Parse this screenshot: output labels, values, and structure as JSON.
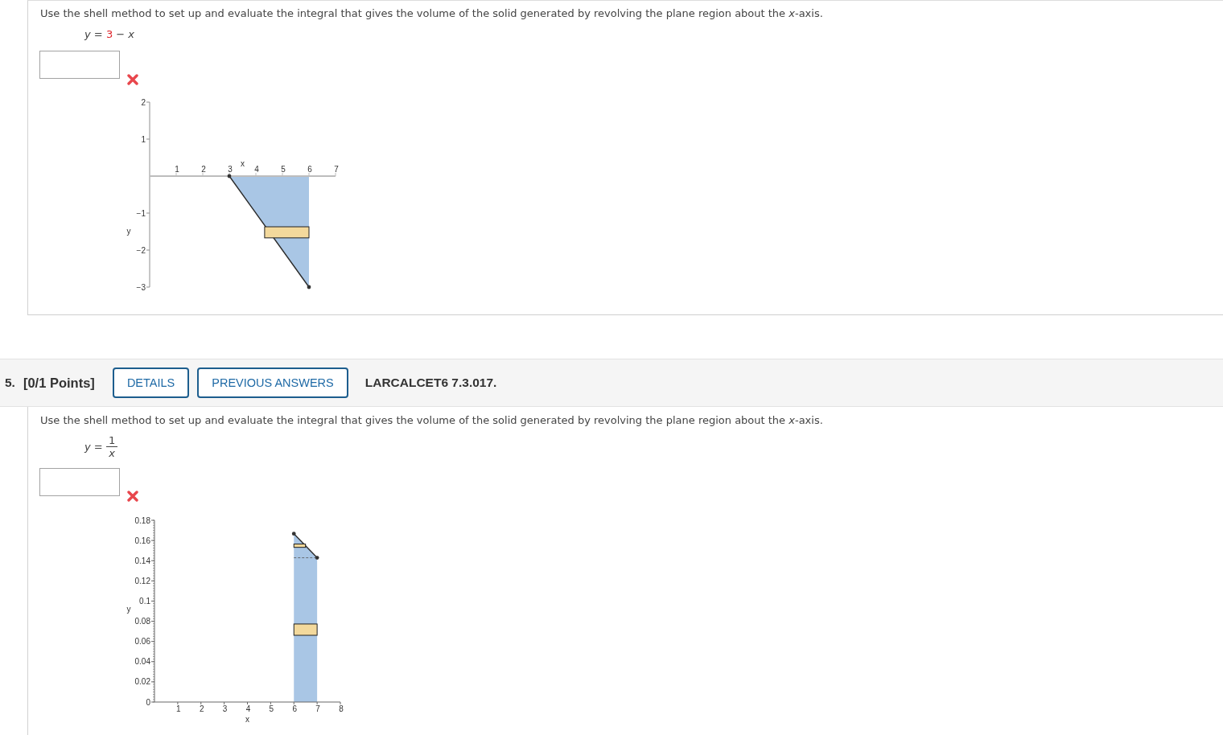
{
  "questions": [
    {
      "prompt": "Use the shell method to set up and evaluate the integral that gives the volume of the solid generated by revolving the plane region about the *x*-axis.",
      "equation": {
        "parts": [
          {
            "kind": "variable",
            "text": "y"
          },
          {
            "kind": "symbol",
            "text": "="
          },
          {
            "kind": "given",
            "text": "3"
          },
          {
            "kind": "symbol",
            "text": "−"
          },
          {
            "kind": "variable",
            "text": "x"
          }
        ]
      },
      "answer_box": {
        "correct": false
      },
      "chart_data": {
        "type": "area",
        "xlabel": "x",
        "ylabel": "y",
        "xlim": [
          0,
          7
        ],
        "ylim": [
          -3,
          2
        ],
        "xticks": [
          1,
          2,
          3,
          4,
          5,
          6,
          7
        ],
        "yticks": [
          {
            "value": -3,
            "label": "−3"
          },
          {
            "value": -2,
            "label": "−2"
          },
          {
            "value": -1,
            "label": "−1"
          },
          1,
          2
        ],
        "series": [
          {
            "type": "area",
            "color": "#a9c6e5",
            "x": [
              3,
              6
            ],
            "values": [
              0,
              -3
            ]
          }
        ]
      }
    },
    {
      "header": {
        "number": "5.",
        "points": "[0/1 Points]",
        "buttons": [
          "DETAILS",
          "PREVIOUS ANSWERS"
        ],
        "reference": "LARCALCET6 7.3.017."
      },
      "prompt": "Use the shell method to set up and evaluate the integral that gives the volume of the solid generated by revolving the plane region about the *x*-axis.",
      "equation": {
        "parts": [
          {
            "kind": "variable",
            "text": "y"
          },
          {
            "kind": "symbol",
            "text": "="
          },
          {
            "kind": "fraction",
            "numerator": "1",
            "denominator": "x"
          }
        ]
      },
      "answer_box": {
        "correct": false
      },
      "chart_data": {
        "type": "area",
        "xlabel": "x",
        "ylabel": "y",
        "xlim": [
          0,
          8
        ],
        "ylim": [
          0,
          0.18
        ],
        "xticks": [
          1,
          2,
          3,
          4,
          5,
          6,
          7,
          8
        ],
        "yticks": [
          0,
          0.02,
          0.04,
          0.06,
          0.08,
          0.1,
          0.12,
          0.14,
          0.16,
          0.18
        ],
        "series": [
          {
            "type": "area",
            "color": "#a9c6e5",
            "x": [
              6,
              7
            ],
            "values": [
              0.1667,
              0.1429
            ]
          },
          {
            "type": "line",
            "color": "#555555",
            "line_style": "dashed",
            "x": [
              6,
              7
            ],
            "values": [
              0.1429,
              0.1429
            ]
          }
        ]
      }
    }
  ]
}
